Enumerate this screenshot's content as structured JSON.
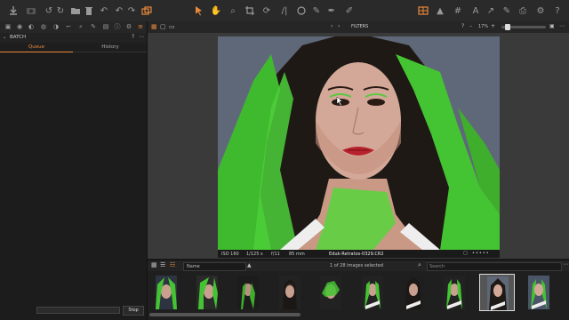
{
  "sidebar": {
    "batch_title": "BATCH",
    "tabs": [
      "Queue",
      "History"
    ],
    "stop_label": "Stop",
    "progress": 0
  },
  "viewer": {
    "panel_title": "FILTERS",
    "zoom_label": "17%",
    "info": {
      "iso": "ISO 160",
      "shutter": "1/125 s",
      "aperture": "f/11",
      "focal": "85 mm",
      "filename": "Eduk-Retratos-0329.CR2"
    }
  },
  "browser": {
    "sort_label": "Name",
    "count_text": "1 of 28 images selected",
    "search_placeholder": "Search"
  },
  "colors": {
    "accent": "#e8883a",
    "mask_green": "#4ccf38"
  },
  "filmstrip": {
    "selected_index": 8,
    "thumbnail_count": 10
  }
}
